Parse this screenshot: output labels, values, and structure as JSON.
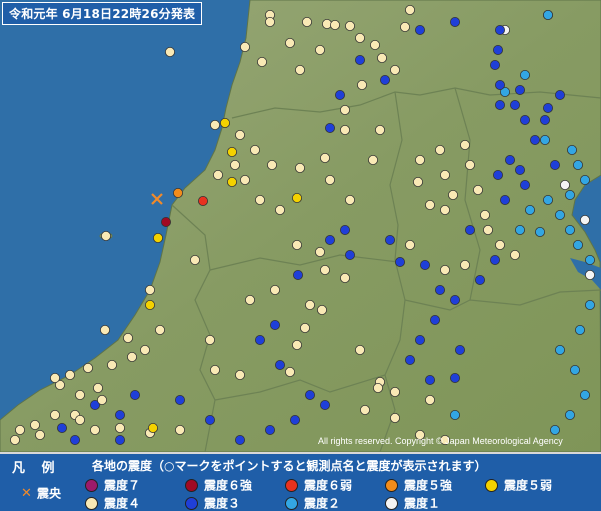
{
  "header": {
    "title": "令和元年 6月18日22時26分発表"
  },
  "copyright": "All rights reserved. Copyright © Japan Meteorological Agency",
  "legend": {
    "title": "凡 例",
    "description": "各地の震度（○マークをポイントすると観測点名と震度が表示されます）",
    "epicenter_label": "震央",
    "items": [
      {
        "label": "震度７",
        "color": "#9c1a6a"
      },
      {
        "label": "震度６強",
        "color": "#a10a23"
      },
      {
        "label": "震度６弱",
        "color": "#e8321f"
      },
      {
        "label": "震度５強",
        "color": "#f28c1b"
      },
      {
        "label": "震度５弱",
        "color": "#f4d200"
      },
      {
        "label": "震度４",
        "color": "#f9e9b5"
      },
      {
        "label": "震度３",
        "color": "#1f3fd8"
      },
      {
        "label": "震度２",
        "color": "#33a6e3"
      },
      {
        "label": "震度１",
        "color": "#f4f4f4"
      }
    ]
  },
  "colors": {
    "sea": "#2f6fa8",
    "land": "#8da06a",
    "header_bg": "#1f5ea8"
  }
}
